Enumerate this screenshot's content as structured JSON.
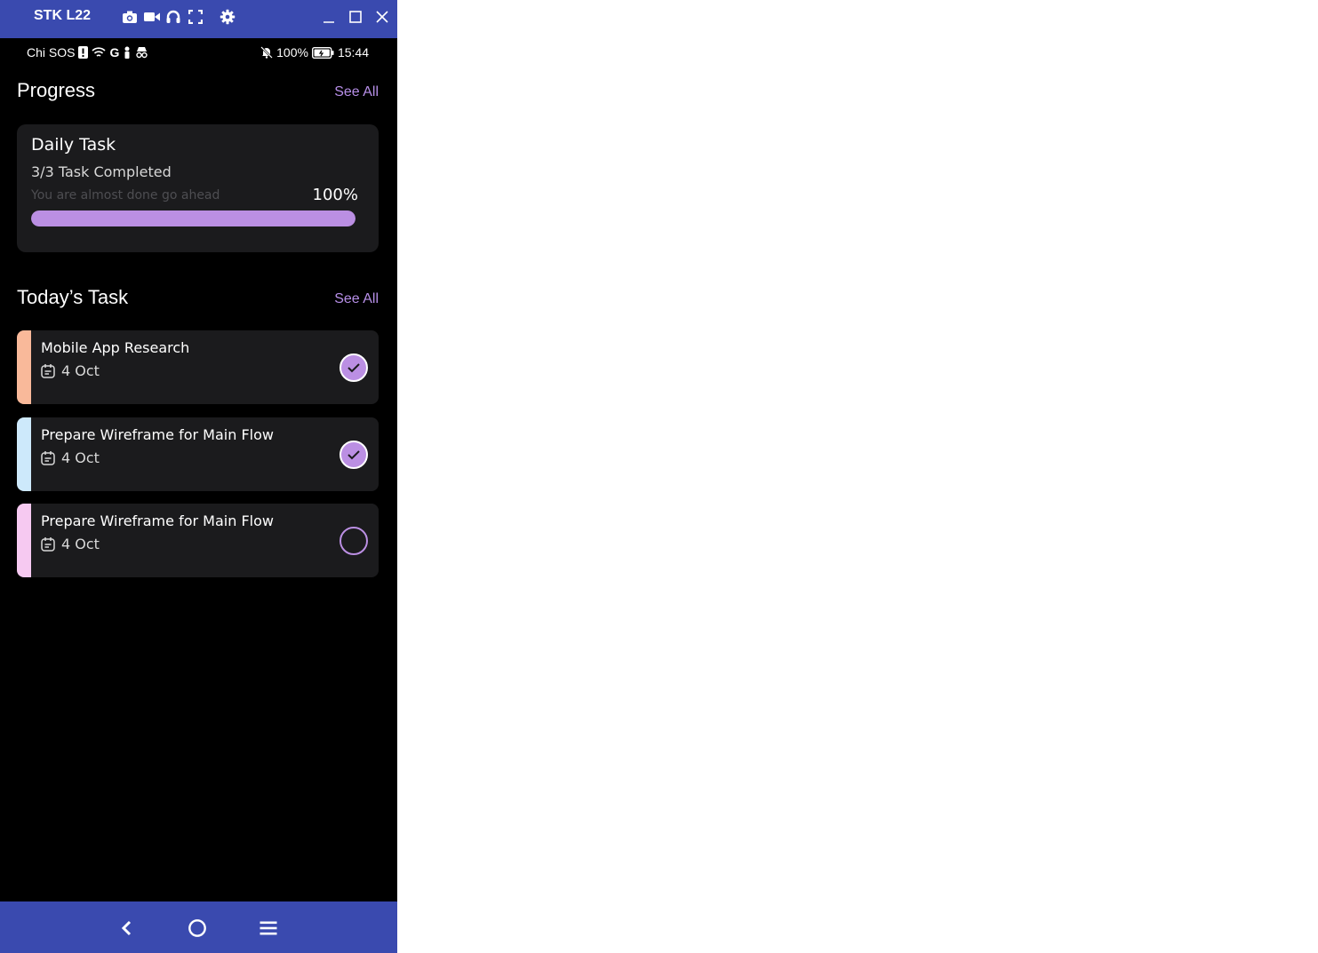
{
  "window": {
    "title": "STK L22",
    "tools": [
      "camera-icon",
      "video-icon",
      "headset-icon",
      "fullscreen-icon",
      "gear-icon"
    ],
    "controls": [
      "minimize-icon",
      "maximize-icon",
      "close-icon"
    ]
  },
  "statusbar": {
    "carrier": "Chi SOS",
    "battery": "100%",
    "time": "15:44"
  },
  "progress_section": {
    "title": "Progress",
    "see_all": "See All",
    "card": {
      "title": "Daily Task",
      "subtitle": "3/3 Task Completed",
      "hint": "You are almost done go ahead",
      "percent_label": "100%",
      "percent": 100
    }
  },
  "tasks_section": {
    "title": "Today’s Task",
    "see_all": "See All",
    "items": [
      {
        "name": "Mobile App Research",
        "date": "4 Oct",
        "done": true,
        "color": "#f9b99a"
      },
      {
        "name": "Prepare Wireframe for Main Flow",
        "date": "4 Oct",
        "done": true,
        "color": "#cde9fb"
      },
      {
        "name": "Prepare Wireframe for Main Flow",
        "date": "4 Oct",
        "done": false,
        "color": "#f6c9f1"
      }
    ]
  },
  "colors": {
    "accent": "#bb8fe3",
    "emulator_chrome": "#3a4aaf",
    "card_bg": "#1b1b1d"
  },
  "navbar": [
    "back-icon",
    "home-icon",
    "menu-icon"
  ]
}
